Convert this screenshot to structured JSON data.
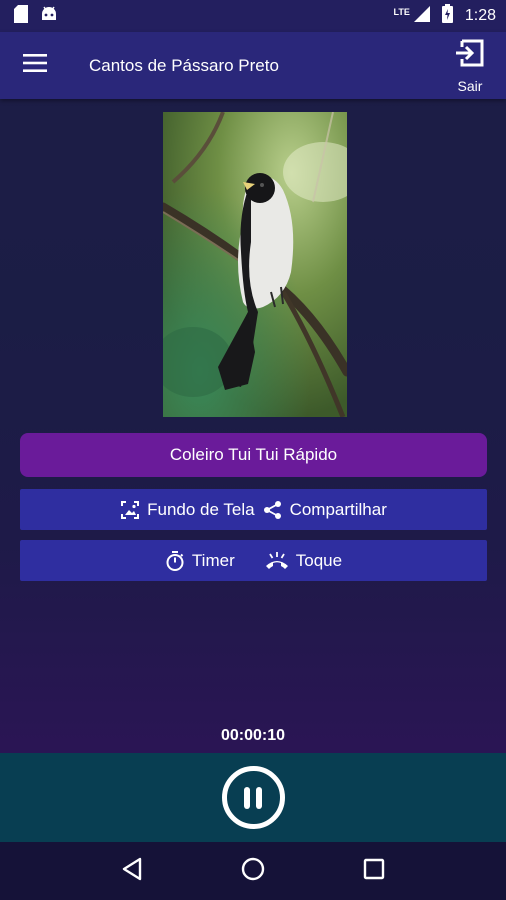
{
  "status_bar": {
    "network": "LTE",
    "time": "1:28"
  },
  "app_bar": {
    "title": "Cantos de Pássaro Preto",
    "exit_label": "Sair"
  },
  "photo": {
    "subject": "bird on branch"
  },
  "buttons": {
    "song": "Coleiro Tui Tui Rápido",
    "wallpaper": "Fundo de Tela",
    "share": "Compartilhar",
    "timer": "Timer",
    "ringtone": "Toque"
  },
  "player": {
    "elapsed": "00:00:10",
    "state": "playing"
  },
  "colors": {
    "primary_button": "#6a1b9a",
    "secondary_button": "#2f2ea0",
    "app_bar": "#2a277a",
    "player_bar": "#083e52"
  }
}
